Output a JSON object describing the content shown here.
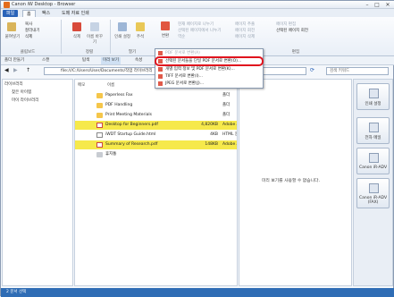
{
  "window": {
    "title": "Canon iW Desktop - Browser"
  },
  "menu_tabs": [
    "파일",
    "홈",
    "팩스",
    "도메 자료 인쇄"
  ],
  "ribbon": {
    "paste": "붙여넣기",
    "copy": "복사",
    "cut": "잘라내기",
    "delete_small": "삭제",
    "clipboard": "클립보드",
    "delete": "삭제",
    "rename": "이름\n바꾸기",
    "edit_group": "정렬",
    "open_settings": "인쇄\n설정",
    "annotation": "주석",
    "open_group": "열기",
    "convert": "변환",
    "convert_dropdown_top": "PDF 문서로 변환(A)",
    "small_right": [
      "현재 페이지로 나누기",
      "선택된 페이지에서 나누기",
      "역순",
      "페이지 추출",
      "페이지 회전",
      "페이지 삭제",
      "페이지 편집",
      "선택된 페이지 회전"
    ],
    "doc_group": "편집"
  },
  "toolbar": [
    "폴더 만들기",
    "스캔",
    "탐색",
    "미리 보기",
    "속성"
  ],
  "address": "file:///C:/Users/User/Documents/작업 라이브러리",
  "search_placeholder": "검색 키워드",
  "tree": [
    "라이브러리",
    "찾은 아이템",
    "마이 라이브러리"
  ],
  "columns": {
    "note": "메모",
    "name": "이름",
    "size": "크기",
    "type": "형식"
  },
  "files": [
    {
      "name": "Paperless Fax",
      "size": "",
      "type": "폴더",
      "kind": "folder",
      "selected": false
    },
    {
      "name": "PDF Handling",
      "size": "",
      "type": "폴더",
      "kind": "folder",
      "selected": false
    },
    {
      "name": "Print Meeting Materials",
      "size": "",
      "type": "폴더",
      "kind": "folder",
      "selected": false
    },
    {
      "name": "Desktop for Beginners.pdf",
      "size": "4,820KB",
      "type": "Adobe A",
      "kind": "pdf",
      "selected": true
    },
    {
      "name": "iWDT Startup Guide.html",
      "size": "4KB",
      "type": "HTML 문",
      "kind": "html",
      "selected": false
    },
    {
      "name": "Summary of Research.pdf",
      "size": "148KB",
      "type": "Adobe A",
      "kind": "pdf",
      "selected": true
    },
    {
      "name": "휴지통",
      "size": "",
      "type": "",
      "kind": "trash",
      "selected": false
    }
  ],
  "preview_message": "미리 보기를 사용할 수 없습니다.",
  "side_buttons": [
    "인쇄 설정",
    "전자 메일",
    "Canon iR-ADV",
    "Canon iR-ADV\n(FAX)"
  ],
  "dropdown": [
    {
      "label": "PDF 문서로 변환(A)",
      "dim": true
    },
    {
      "label": "선택된 문서들을 단일 PDF 문서로 변환(O)...",
      "dim": false
    },
    {
      "label": "개별 입력 정보 및 PDF 문서로 변환(K)...",
      "dim": false
    },
    {
      "label": "TIFF 문서로 변환(I)...",
      "dim": false
    },
    {
      "label": "JPEG 문서로 변환(J)...",
      "dim": false
    }
  ],
  "status": "2 문서 선택",
  "colors": {
    "accent": "#2a63b8",
    "selection": "#f6e94b",
    "highlight": "#e0141e"
  }
}
